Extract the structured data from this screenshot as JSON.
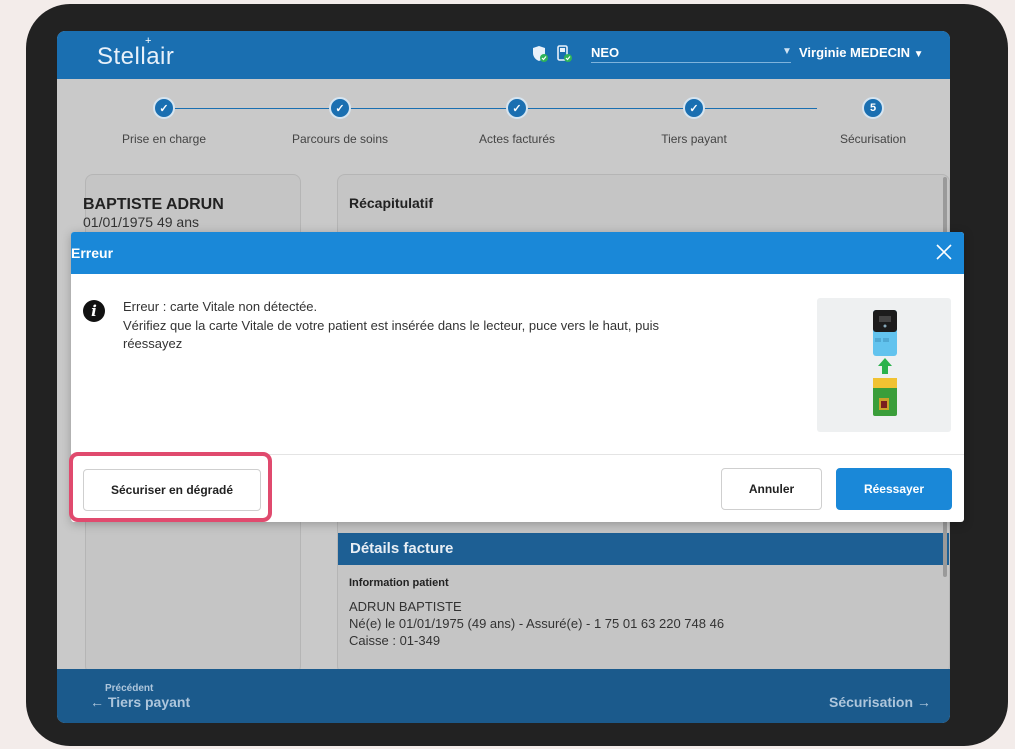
{
  "app": {
    "logo": "Stellair",
    "device": "NEO",
    "user": "Virginie MEDECIN"
  },
  "stepper": {
    "steps": [
      {
        "label": "Prise en charge",
        "marker": "✓"
      },
      {
        "label": "Parcours de soins",
        "marker": "✓"
      },
      {
        "label": "Actes facturés",
        "marker": "✓"
      },
      {
        "label": "Tiers payant",
        "marker": "✓"
      },
      {
        "label": "Sécurisation",
        "marker": "5"
      }
    ]
  },
  "patient": {
    "name": "BAPTISTE ADRUN",
    "dob": "01/01/1975 49 ans"
  },
  "main": {
    "recap_title": "Récapitulatif",
    "details_title": "Détails facture",
    "info_title": "Information patient",
    "info_lines": [
      "ADRUN BAPTISTE",
      "Né(e) le 01/01/1975 (49 ans) - Assuré(e) - 1 75 01 63 220 748 46",
      "Caisse : 01-349"
    ]
  },
  "footer": {
    "prev_small": "Précédent",
    "prev_label": "← Tiers payant",
    "next_label": "Sécurisation →"
  },
  "modal": {
    "title": "Erreur",
    "message_lines": [
      "Erreur : carte Vitale non détectée.",
      "Vérifiez que la carte Vitale de votre patient est insérée dans le lecteur, puce vers le haut, puis",
      "réessayez"
    ],
    "btn_degrade": "Sécuriser en dégradé",
    "btn_cancel": "Annuler",
    "btn_retry": "Réessayer"
  },
  "colors": {
    "primary": "#1a88d8",
    "header": "#1a6fb1",
    "footer": "#1b5a8c",
    "highlight": "#e04a6e"
  }
}
